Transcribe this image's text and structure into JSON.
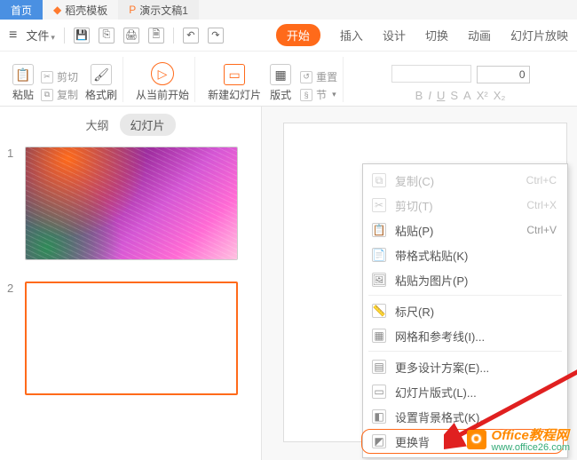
{
  "tabs": {
    "home": "首页",
    "template": "稻壳模板",
    "doc": "演示文稿1"
  },
  "file_row": {
    "file": "文件"
  },
  "menu": {
    "start": "开始",
    "insert": "插入",
    "design": "设计",
    "transition": "切换",
    "animation": "动画",
    "slideshow": "幻灯片放映"
  },
  "ribbon": {
    "paste": "粘贴",
    "cut": "剪切",
    "copy": "复制",
    "format_painter": "格式刷",
    "from_current": "从当前开始",
    "new_slide": "新建幻灯片",
    "layout": "版式",
    "section": "节",
    "reset": "重置",
    "font_size": "0"
  },
  "slide_panel": {
    "outline": "大纲",
    "slides": "幻灯片",
    "n1": "1",
    "n2": "2"
  },
  "context_menu": {
    "copy": "复制(C)",
    "copy_sc": "Ctrl+C",
    "cut": "剪切(T)",
    "cut_sc": "Ctrl+X",
    "paste": "粘贴(P)",
    "paste_sc": "Ctrl+V",
    "paste_format": "带格式粘贴(K)",
    "paste_image": "粘贴为图片(P)",
    "ruler": "标尺(R)",
    "grid": "网格和参考线(I)...",
    "more_design": "更多设计方案(E)...",
    "slide_layout": "幻灯片版式(L)...",
    "bg_format": "设置背景格式(K)...",
    "change_bg": "更换背"
  },
  "watermark": {
    "brand": "Office教程网",
    "url": "www.office26.com"
  }
}
